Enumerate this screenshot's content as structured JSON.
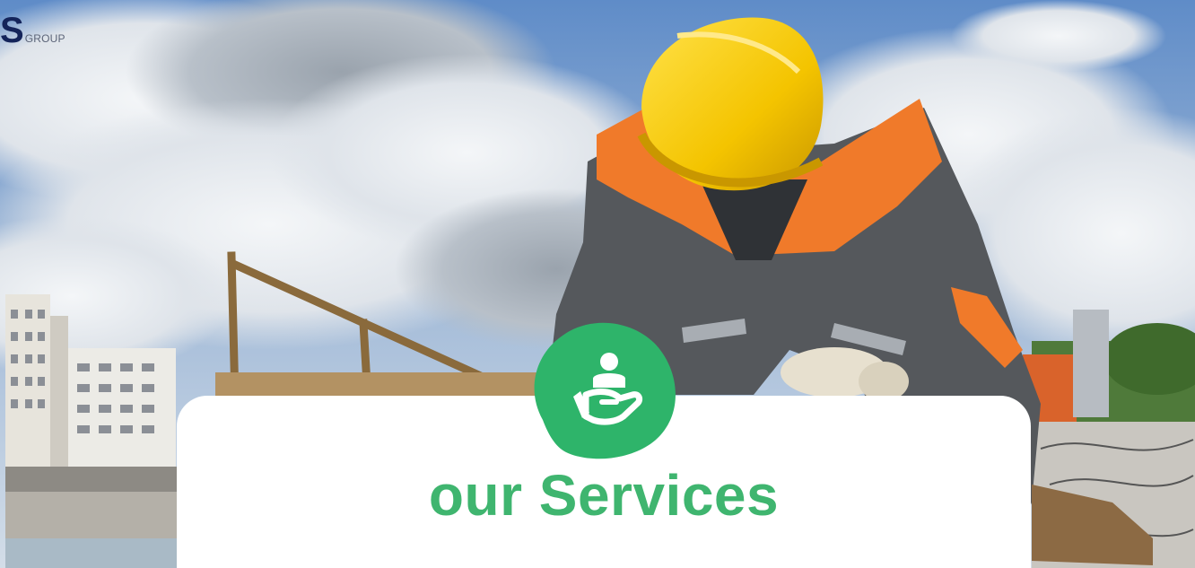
{
  "logo": {
    "mark": "S",
    "sub": "GROUP"
  },
  "hero": {
    "image": "construction-worker-photo"
  },
  "services": {
    "title": "our Services",
    "badge_icon": "hand-holding-person-icon",
    "title_color": "#3fb56f",
    "badge_color": "#2eb46a"
  }
}
